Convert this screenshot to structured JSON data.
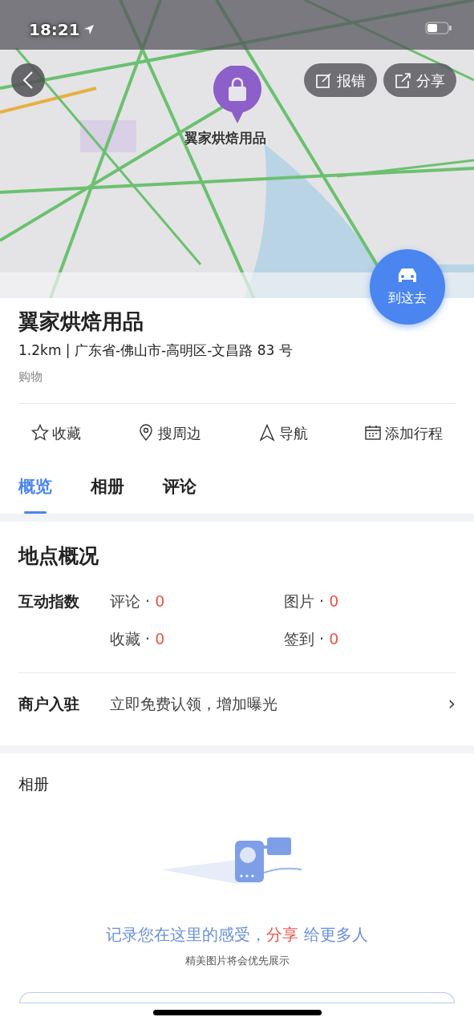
{
  "status_bar": {
    "time": "18:21"
  },
  "map": {
    "kind": "picture",
    "marker_label": "翼家烘焙用品"
  },
  "map_buttons": [
    {
      "label": "报错",
      "kind": "report"
    },
    {
      "label": "分享",
      "kind": "share"
    }
  ],
  "drive_button": {
    "label": "到这去"
  },
  "place": {
    "name": "翼家烘焙用品",
    "distance": "1.2km",
    "separator": "|",
    "address": "广东省-佛山市-高明区-文昌路 83 号",
    "category": "购物"
  },
  "actions": [
    {
      "label": "收藏",
      "kind": "star"
    },
    {
      "label": "搜周边",
      "kind": "pin"
    },
    {
      "label": "导航",
      "kind": "nav"
    },
    {
      "label": "添加行程",
      "kind": "calendar"
    }
  ],
  "tabs": [
    {
      "label": "概览",
      "selected": true
    },
    {
      "label": "相册",
      "selected": false
    },
    {
      "label": "评论",
      "selected": false
    }
  ],
  "overview": {
    "title": "地点概况",
    "interaction_label": "互动指数",
    "stats": [
      {
        "label": "评论 · ",
        "value": "0"
      },
      {
        "label": "图片 · ",
        "value": "0"
      },
      {
        "label": "收藏 · ",
        "value": "0"
      },
      {
        "label": "签到 · ",
        "value": "0"
      }
    ],
    "merchant_label": "商户入驻",
    "merchant_text": "立即免费认领，增加曝光",
    "chevron": "›"
  },
  "album": {
    "title": "相册",
    "prompt": [
      {
        "text": "记录您在这里的感受，",
        "kind": "normal"
      },
      {
        "text": "分享",
        "kind": "highlight"
      },
      {
        "text": " 给更多人",
        "kind": "normal"
      }
    ],
    "hint": "精美图片将会优先展示"
  }
}
